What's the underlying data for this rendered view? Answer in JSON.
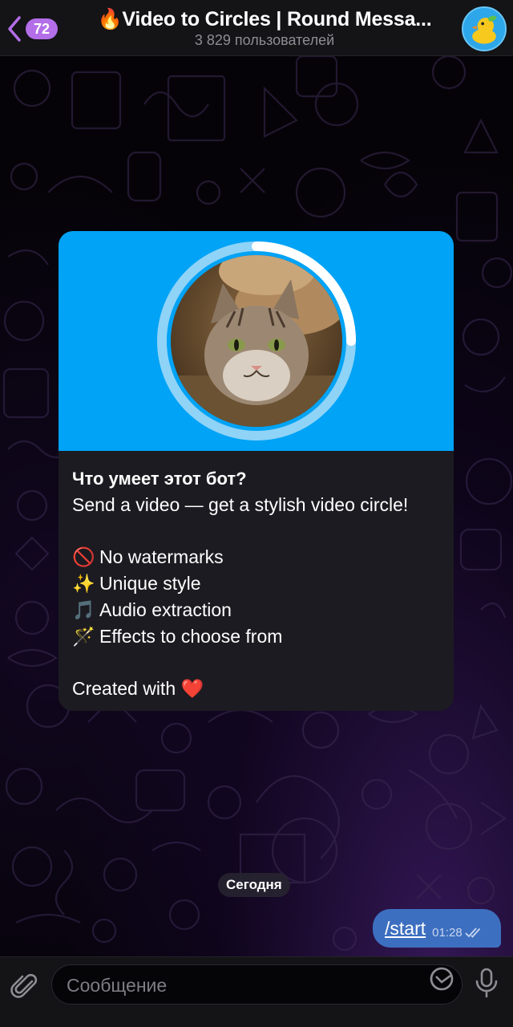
{
  "header": {
    "back_badge": "72",
    "title": "🔥Video to Circles | Round Messa...",
    "subtitle": "3 829 пользователей"
  },
  "bot_info": {
    "heading": "Что умеет этот бот?",
    "intro": "Send a video — get a stylish video circle!",
    "features": [
      {
        "icon": "🚫",
        "text": "No watermarks"
      },
      {
        "icon": "✨",
        "text": "Unique style"
      },
      {
        "icon": "🎵",
        "text": "Audio extraction"
      },
      {
        "icon": "🪄",
        "text": "Effects to choose from"
      }
    ],
    "footer_text": "Created with",
    "footer_icon": "❤️"
  },
  "date_separator": "Сегодня",
  "outgoing_message": {
    "text": "/start",
    "time": "01:28"
  },
  "composer": {
    "placeholder": "Сообщение"
  },
  "colors": {
    "accent": "#b36ee8",
    "media_bg": "#00a3f5",
    "bubble_out": "#3d6fc0",
    "card_bg": "#1c1b21"
  },
  "icons": {
    "back": "chevron-left-icon",
    "attach": "paperclip-icon",
    "sticker": "sticker-icon",
    "mic": "microphone-icon"
  }
}
